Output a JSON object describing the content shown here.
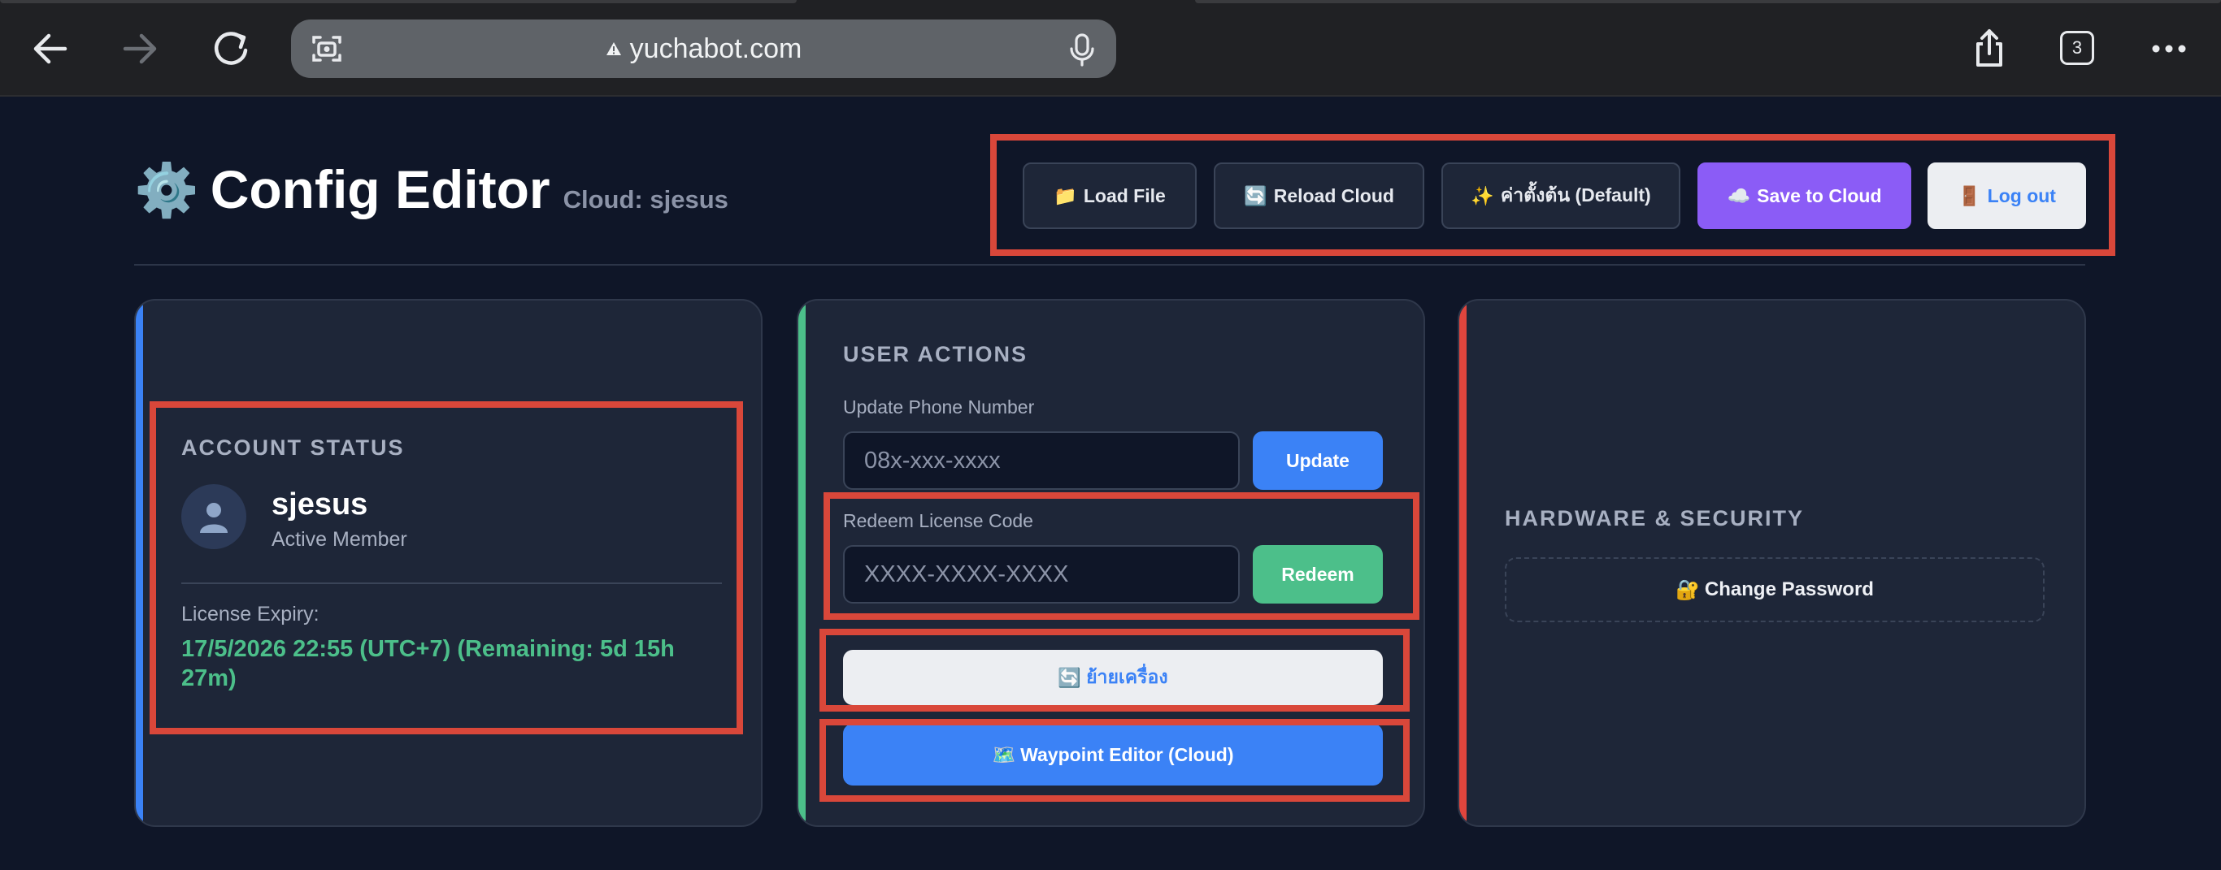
{
  "browser": {
    "url": "yuchabot.com",
    "url_warning_icon": "warning-triangle-icon",
    "tab_count": "3"
  },
  "header": {
    "gear_glyph": "⚙️",
    "title": "Config Editor",
    "cloud_user": "Cloud: sjesus"
  },
  "toolbar": {
    "load_file": {
      "emoji": "📁",
      "label": "Load File"
    },
    "reload_cloud": {
      "emoji": "🔄",
      "label": "Reload Cloud"
    },
    "default": {
      "emoji": "✨",
      "label": "ค่าตั้งต้น (Default)"
    },
    "save_cloud": {
      "emoji": "☁️",
      "label": "Save to Cloud"
    },
    "logout": {
      "emoji": "🚪",
      "label": "Log out"
    }
  },
  "account": {
    "section": "ACCOUNT STATUS",
    "username": "sjesus",
    "status": "Active Member",
    "expiry_label": "License Expiry:",
    "expiry_value": "17/5/2026 22:55 (UTC+7) (Remaining: 5d 15h 27m)"
  },
  "actions": {
    "section": "USER ACTIONS",
    "phone_label": "Update Phone Number",
    "phone_placeholder": "08x-xxx-xxxx",
    "phone_button": "Update",
    "redeem_label": "Redeem License Code",
    "redeem_placeholder": "XXXX-XXXX-XXXX",
    "redeem_button": "Redeem",
    "move_device": {
      "emoji": "🔄",
      "label": "ย้ายเครื่อง"
    },
    "waypoint": {
      "emoji": "🗺️",
      "label": "Waypoint Editor (Cloud)"
    }
  },
  "hardware": {
    "section": "HARDWARE & SECURITY",
    "change_password": {
      "emoji": "🔐",
      "label": "Change Password"
    }
  },
  "colors": {
    "page_bg": "#0f1628",
    "card_bg": "#1e2638",
    "accent_blue": "#3b82f6",
    "accent_green": "#4cbf8a",
    "accent_red": "#e0453d",
    "primary_purple": "#8b5cf6",
    "highlight_red": "#d9473a"
  }
}
